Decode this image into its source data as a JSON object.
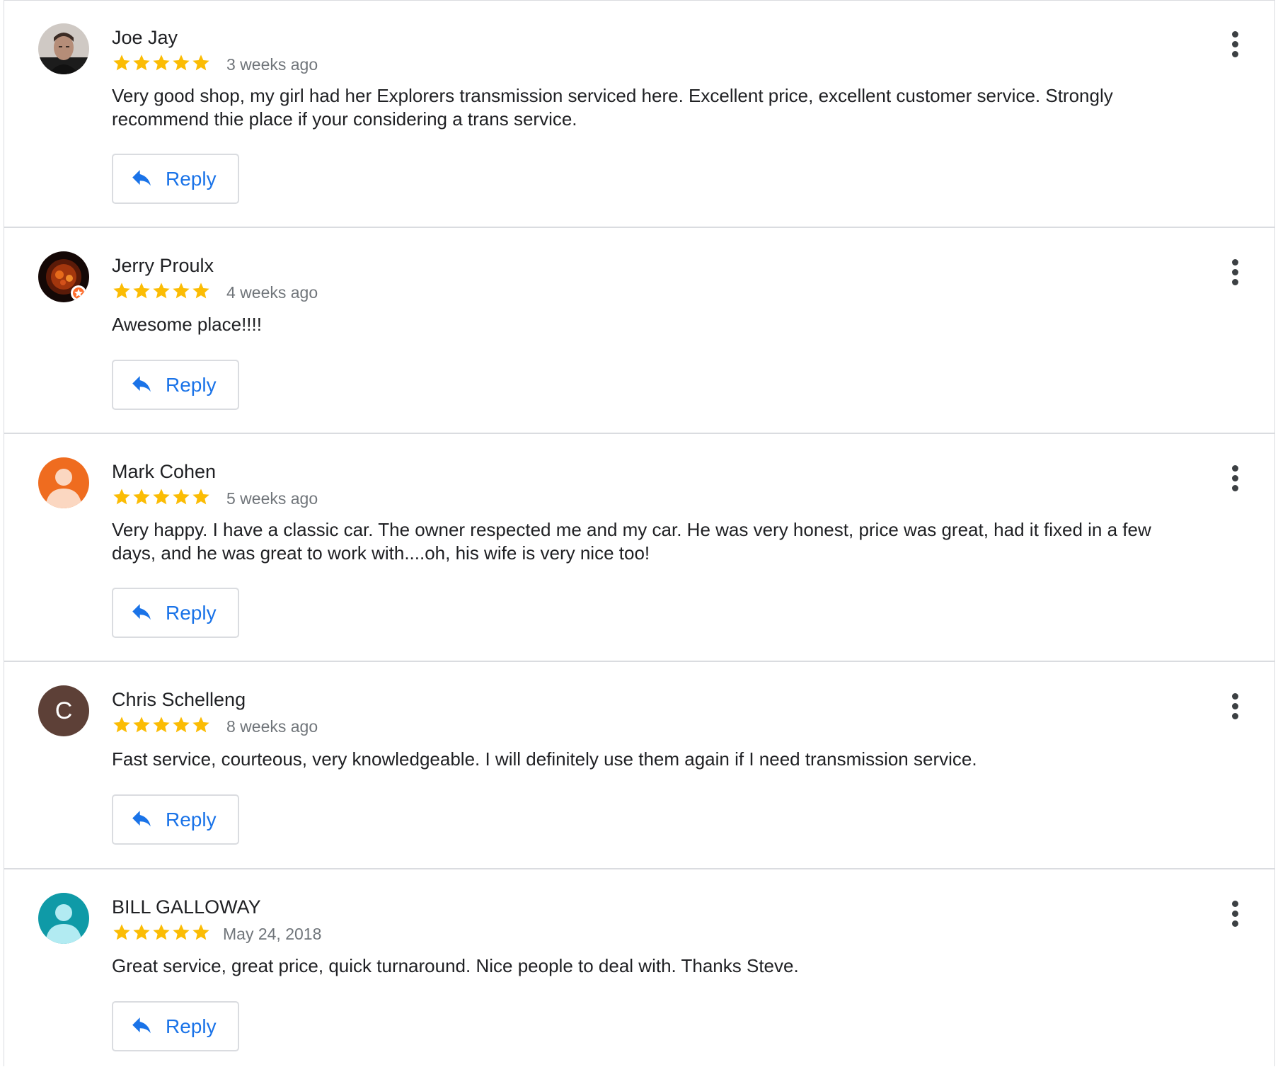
{
  "colors": {
    "star": "#fbbc04",
    "reply_text": "#1a73e8",
    "divider": "#dadce0",
    "muted_text": "#70757a"
  },
  "reviews": [
    {
      "name": "Joe Jay",
      "rating": 5,
      "date": "3 weeks ago",
      "text": "Very good shop, my girl had her Explorers transmission serviced here. Excellent price, excellent customer service. Strongly recommend thie place if your considering a trans service.",
      "reply_label": "Reply",
      "avatar": "photo"
    },
    {
      "name": "Jerry Proulx",
      "rating": 5,
      "date": "4 weeks ago",
      "text": "Awesome place!!!!",
      "reply_label": "Reply",
      "avatar": "photo-local-guide"
    },
    {
      "name": "Mark Cohen",
      "rating": 5,
      "date": "5 weeks ago",
      "text": "Very happy. I have a classic car. The owner respected me and my car. He was very honest, price was great, had it fixed in a few days, and he was great to work with....oh, his wife is very nice too!",
      "reply_label": "Reply",
      "avatar": "default-orange"
    },
    {
      "name": "Chris Schelleng",
      "rating": 5,
      "date": "8 weeks ago",
      "text": "Fast service, courteous, very knowledgeable. I will definitely use them again if I need transmission service.",
      "reply_label": "Reply",
      "avatar": "letter",
      "avatar_letter": "C"
    },
    {
      "name": "BILL GALLOWAY",
      "rating": 5,
      "date": "May 24, 2018",
      "text": "Great service, great price, quick turnaround. Nice people to deal with. Thanks Steve.",
      "reply_label": "Reply",
      "avatar": "default-teal"
    }
  ]
}
